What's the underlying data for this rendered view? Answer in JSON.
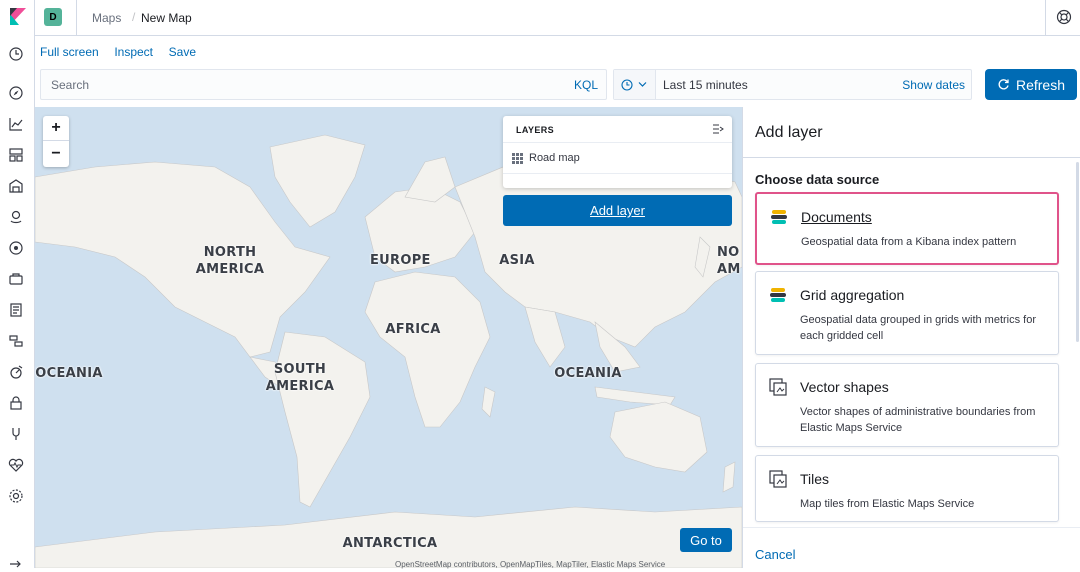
{
  "header": {
    "space_initial": "D",
    "breadcrumbs": [
      "Maps",
      "New Map"
    ],
    "breadcrumb_separator": "/"
  },
  "nav": {
    "icons": [
      "recent-icon",
      "discover-icon",
      "visualize-icon",
      "dashboard-icon",
      "canvas-icon",
      "maps-icon",
      "ml-icon",
      "infrastructure-icon",
      "logs-icon",
      "apm-icon",
      "uptime-icon",
      "siem-icon",
      "dev-tools-icon",
      "monitoring-icon",
      "management-icon"
    ]
  },
  "app_menu": {
    "full_screen": "Full screen",
    "inspect": "Inspect",
    "save": "Save"
  },
  "query": {
    "placeholder": "Search",
    "language": "KQL"
  },
  "time": {
    "range": "Last 15 minutes",
    "show_dates": "Show dates",
    "refresh": "Refresh"
  },
  "map": {
    "zoom_in": "+",
    "zoom_out": "−",
    "labels": {
      "north_america": "NORTH\nAMERICA",
      "europe": "EUROPE",
      "asia": "ASIA",
      "africa": "AFRICA",
      "south_america": "SOUTH\nAMERICA",
      "oceania_left": "OCEANIA",
      "oceania_right": "OCEANIA",
      "antarctica": "ANTARCTICA",
      "north_america_clip": "NO\nAM"
    },
    "layers_title": "LAYERS",
    "layers": [
      {
        "name": "Road map"
      }
    ],
    "add_layer": "Add layer",
    "go_to": "Go to",
    "attribution": "OpenStreetMap contributors, OpenMapTiles, MapTiler, Elastic Maps Service"
  },
  "flyout": {
    "title": "Add layer",
    "subtitle": "Choose data source",
    "sources": [
      {
        "title": "Documents",
        "description": "Geospatial data from a Kibana index pattern",
        "icon": "elastic-icon",
        "selected": true
      },
      {
        "title": "Grid aggregation",
        "description": "Geospatial data grouped in grids with metrics for each gridded cell",
        "icon": "elastic-icon",
        "selected": false
      },
      {
        "title": "Vector shapes",
        "description": "Vector shapes of administrative boundaries from Elastic Maps Service",
        "icon": "ems-icon",
        "selected": false
      },
      {
        "title": "Tiles",
        "description": "Map tiles from Elastic Maps Service",
        "icon": "ems-icon",
        "selected": false
      }
    ],
    "cancel": "Cancel"
  },
  "colors": {
    "primary": "#006bb4",
    "selected_border": "#e0538a",
    "ocean": "#cfe0ef",
    "land": "#f2f2ee"
  }
}
